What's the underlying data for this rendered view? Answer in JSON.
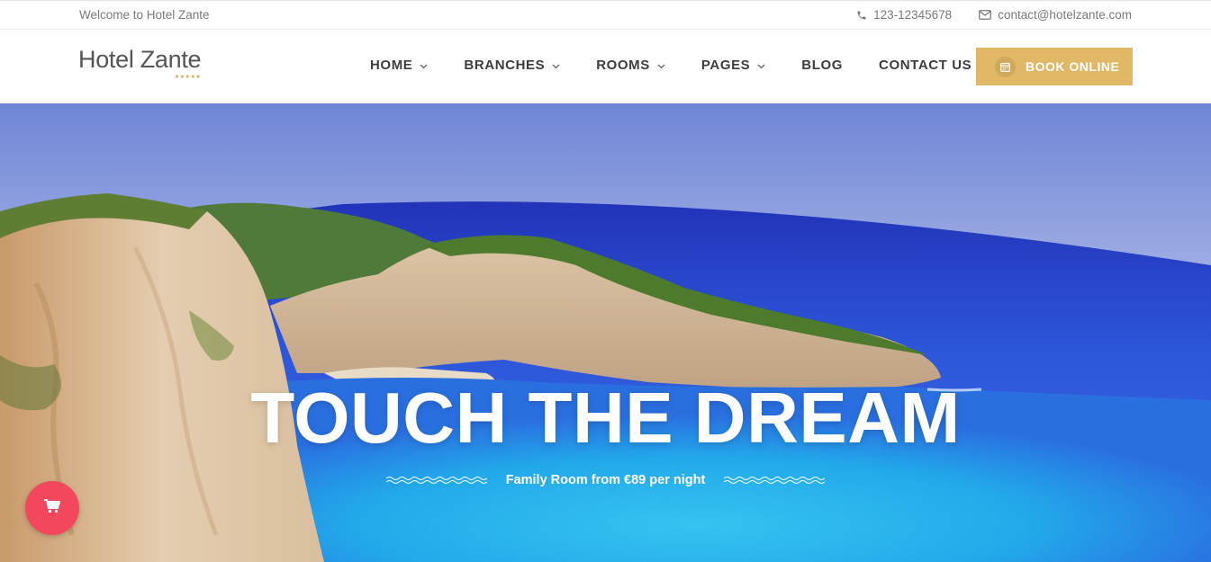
{
  "topbar": {
    "welcome": "Welcome to Hotel Zante",
    "phone": "123-12345678",
    "email": "contact@hotelzante.com"
  },
  "header": {
    "logo": "Hotel Zante",
    "logo_stars": "★★★★★",
    "nav": [
      {
        "label": "HOME",
        "has_dropdown": true
      },
      {
        "label": "BRANCHES",
        "has_dropdown": true
      },
      {
        "label": "ROOMS",
        "has_dropdown": true
      },
      {
        "label": "PAGES",
        "has_dropdown": true
      },
      {
        "label": "BLOG",
        "has_dropdown": false
      },
      {
        "label": "CONTACT US",
        "has_dropdown": false
      }
    ],
    "book_button": "BOOK ONLINE"
  },
  "hero": {
    "title": "TOUCH THE DREAM",
    "subtitle": "Family Room from €89 per night"
  },
  "icons": {
    "phone": "phone-icon",
    "email": "envelope-icon",
    "calendar": "calendar-icon",
    "cart": "shopping-cart-icon",
    "chevron": "chevron-down-icon"
  },
  "colors": {
    "accent_gold": "#e1b865",
    "cart_red": "#f2475c",
    "nav_text": "#3d3d3d",
    "muted_text": "#7a7a7a"
  }
}
